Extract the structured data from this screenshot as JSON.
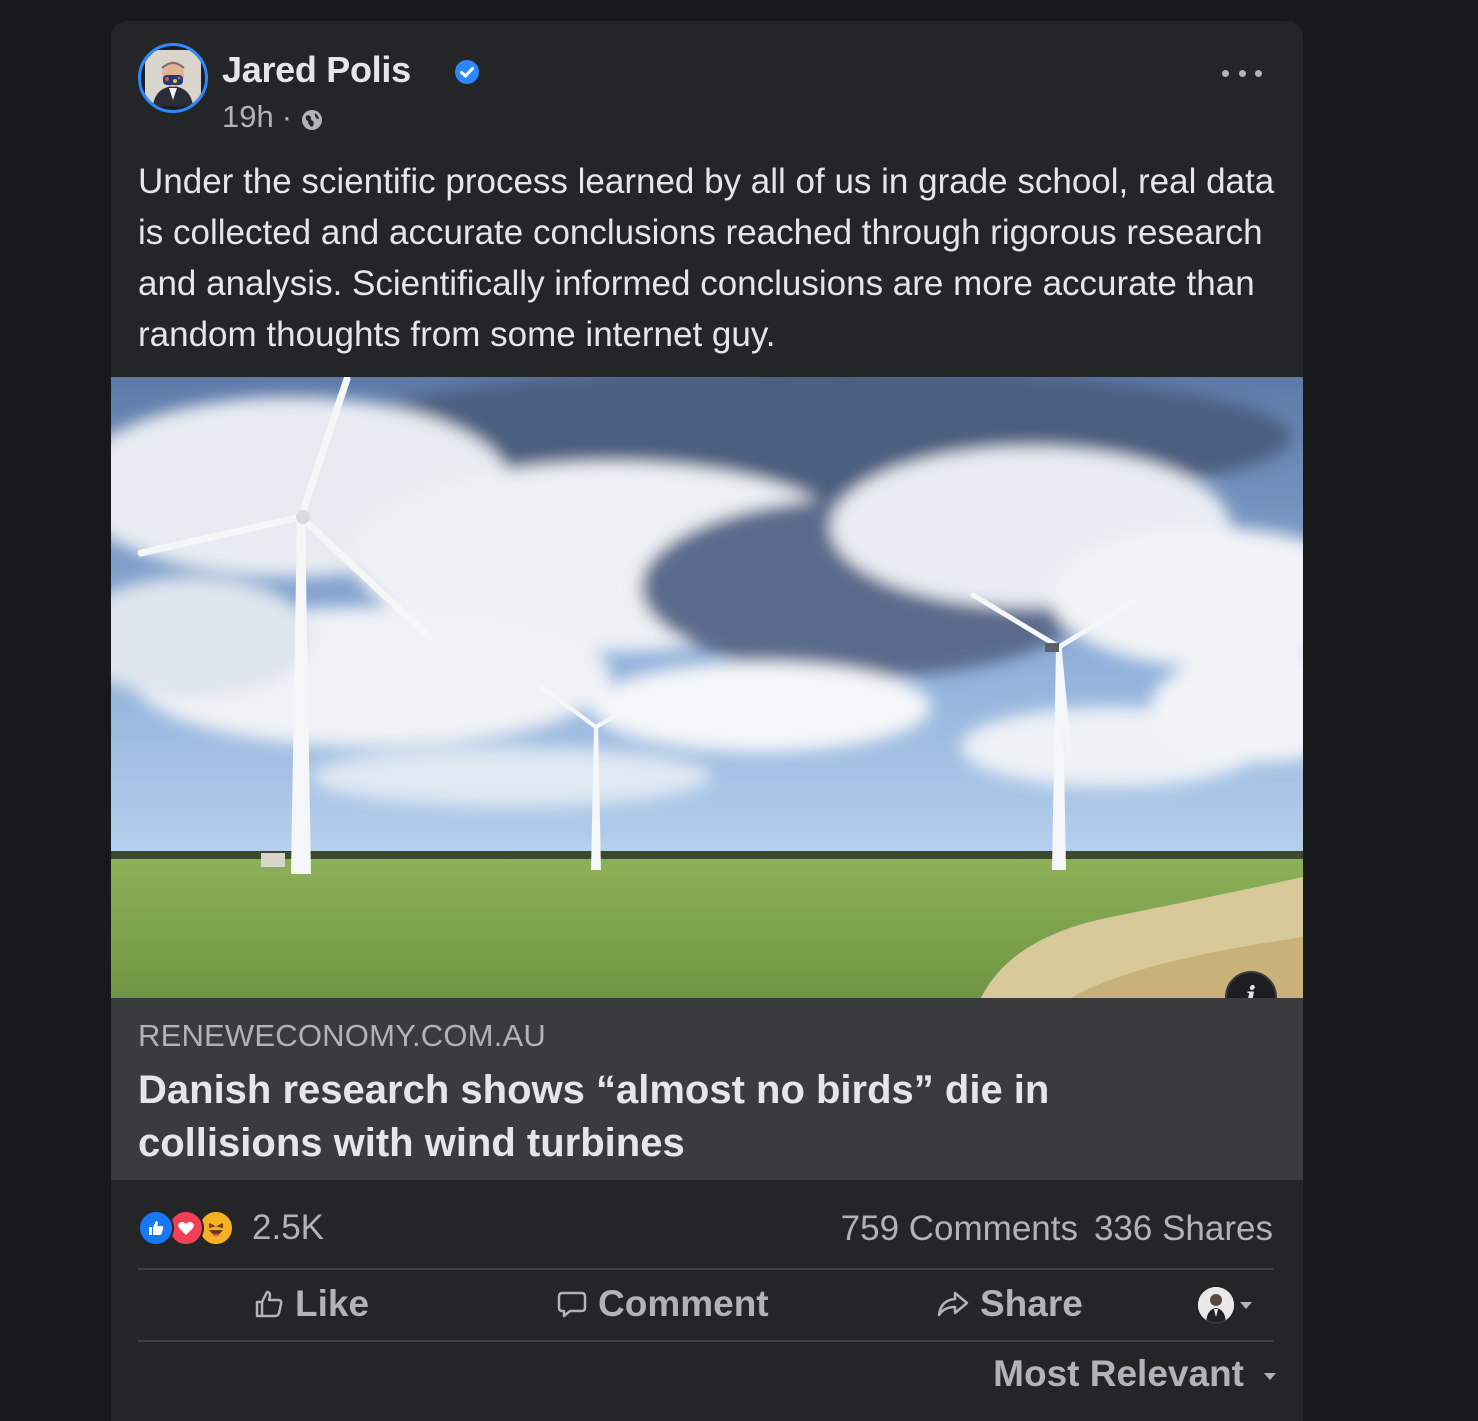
{
  "post": {
    "author_name": "Jared Polis",
    "verified_icon": "verified-badge-icon",
    "time": "19h",
    "separator": "·",
    "audience_icon": "globe-icon",
    "more_icon": "more-options-icon",
    "text": "Under the scientific process learned by all of us in grade school, real data is collected and accurate conclusions reached through rigorous research and analysis. Scientifically informed conclusions are more accurate than random thoughts from some internet guy."
  },
  "link": {
    "image_description_icon": "info-icon",
    "info_glyph": "i",
    "domain": "RENEWECONOMY.COM.AU",
    "headline": "Danish research shows “almost no birds” die in collisions with wind turbines"
  },
  "stats": {
    "reaction_icons": [
      "like-icon",
      "love-icon",
      "haha-icon"
    ],
    "reaction_count": "2.5K",
    "comments": "759 Comments",
    "shares": "336 Shares"
  },
  "actions": {
    "like": "Like",
    "comment": "Comment",
    "share": "Share"
  },
  "comments_sort": {
    "label": "Most Relevant"
  },
  "colors": {
    "background": "#18191a",
    "card": "#242526",
    "caption_bg": "#3a3b3c",
    "primary_text": "#e4e6eb",
    "secondary_text": "#b0b3b8",
    "accent": "#2d88ff",
    "like": "#1877f2",
    "love": "#f33e58",
    "haha": "#f7b125"
  }
}
